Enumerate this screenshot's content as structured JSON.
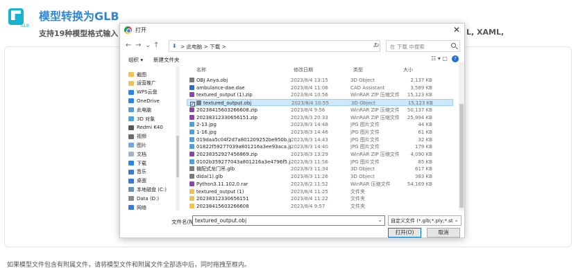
{
  "page": {
    "title": "模型转换为GLB",
    "subtitle": "支持19种模型格式输入：",
    "subtitle_tail": "L, XAML,",
    "logo_tag": "GLB",
    "footnote": "如果模型文件包含有附属文件，请将模型文件和附属文件全部选中后，同时拖拽至框内。"
  },
  "dialog": {
    "title": "打开",
    "close_glyph": "✕",
    "nav": {
      "back": "←",
      "forward": "→",
      "up_recent": "⌄",
      "up": "↑",
      "path": "> 此电脑 > 下载 >",
      "refresh": "↻",
      "search_placeholder": "在 下载 中搜索"
    },
    "toolbar": {
      "organize": "组织 ▾",
      "new_folder": "新建文件夹",
      "view_glyphs": "☷ ▾  ▢"
    },
    "sidebar": [
      {
        "label": "截图",
        "color": "#f2c14e"
      },
      {
        "label": "运营推广",
        "color": "#f2c14e"
      },
      {
        "label": "WPS云盘",
        "color": "#2a86e0"
      },
      {
        "label": "OneDrive",
        "color": "#2a86e0"
      },
      {
        "label": "此电脑",
        "color": "#5b9bd5"
      },
      {
        "label": "3D 对象",
        "color": "#4aa3df"
      },
      {
        "label": "Redmi K40",
        "color": "#555555"
      },
      {
        "label": "视频",
        "color": "#6b6b6b"
      },
      {
        "label": "图片",
        "color": "#6fa8dc"
      },
      {
        "label": "文档",
        "color": "#9fb5c9"
      },
      {
        "label": "下载",
        "color": "#2a86e0"
      },
      {
        "label": "音乐",
        "color": "#3c78d8"
      },
      {
        "label": "桌面",
        "color": "#3c78d8"
      },
      {
        "label": "本地磁盘 (C:)",
        "color": "#6b8fb5"
      },
      {
        "label": "Data (D:)",
        "color": "#8a8a8a"
      },
      {
        "label": "网络",
        "color": "#3c78d8"
      }
    ],
    "columns": {
      "name": "名称",
      "date": "修改日期",
      "type": "类型",
      "size": "大小"
    },
    "files": [
      {
        "name": "OBJ Anya.obj",
        "date": "2023/8/4 13:15",
        "type": "3D Object",
        "size": "2,137 KB",
        "icon": "#7a7a7a"
      },
      {
        "name": "ambulance-dae.dae",
        "date": "2023/8/4 11:06",
        "type": "CAD Assistant",
        "size": "3,589 KB",
        "icon": "#1f6fd1"
      },
      {
        "name": "textured_output (1).zip",
        "date": "2023/8/4 10:56",
        "type": "WinRAR ZIP 压缩文件",
        "size": "15,123 KB",
        "icon": "#8e44ad"
      },
      {
        "name": "textured_output.obj",
        "date": "2023/8/4 10:55",
        "type": "3D Object",
        "size": "15,123 KB",
        "icon": "#7a7a7a",
        "selected": true
      },
      {
        "name": "20238415603266608.zip",
        "date": "2023/8/4 9:56",
        "type": "WinRAR ZIP 压缩文件",
        "size": "50,137 KB",
        "icon": "#8e44ad"
      },
      {
        "name": "20238312330656151.zip",
        "date": "2023/8/3 20:33",
        "type": "WinRAR ZIP 压缩文件",
        "size": "25,994 KB",
        "icon": "#8e44ad"
      },
      {
        "name": "2-13.jpg",
        "date": "2023/8/3 14:48",
        "type": "JPG 图片文件",
        "size": "44 KB",
        "icon": "#4aa3df"
      },
      {
        "name": "1-16.jpg",
        "date": "2023/8/3 14:46",
        "type": "JPG 图片文件",
        "size": "61 KB",
        "icon": "#4aa3df"
      },
      {
        "name": "019daa5c04f2d7a801209252be950b.jpg...",
        "date": "2023/8/3 14:43",
        "type": "JPG 图片文件",
        "size": "32 KB",
        "icon": "#4aa3df"
      },
      {
        "name": "01822f59277039a801216a3ee93aca.jpg",
        "date": "2023/8/3 14:40",
        "type": "JPG 图片文件",
        "size": "179 KB",
        "icon": "#4aa3df"
      },
      {
        "name": "20238352927456869.zip",
        "date": "2023/8/3 13:29",
        "type": "WinRAR ZIP 压缩文件",
        "size": "4,090 KB",
        "icon": "#8e44ad"
      },
      {
        "name": "0102b359277043a801216a3e4796f5.jpg",
        "date": "2023/8/3 11:56",
        "type": "JPG 图片文件",
        "size": "85 KB",
        "icon": "#4aa3df"
      },
      {
        "name": "機配式龙门吊.glb",
        "date": "2023/8/3 11:34",
        "type": "3D Object",
        "size": "617 KB",
        "icon": "#7a7a7a"
      },
      {
        "name": "dida(1).glb",
        "date": "2023/8/3 11:26",
        "type": "3D Object",
        "size": "383 KB",
        "icon": "#7a7a7a"
      },
      {
        "name": "Python3.11.102.0.rar",
        "date": "2023/8/2 11:52",
        "type": "WinRAR 压缩文件",
        "size": "54,169 KB",
        "icon": "#8e44ad"
      },
      {
        "name": "textured_output (1)",
        "date": "2023/8/4 11:25",
        "type": "文件夹",
        "size": "",
        "icon": "#f2c14e"
      },
      {
        "name": "20238312330656151",
        "date": "2023/8/4 11:22",
        "type": "文件夹",
        "size": "",
        "icon": "#f2c14e"
      },
      {
        "name": "20238415603266608",
        "date": "2023/8/4 9:57",
        "type": "文件夹",
        "size": "",
        "icon": "#f2c14e"
      }
    ],
    "filename_label": "文件名(N):",
    "filename_value": "textured_output.obj",
    "filter": "自定义文件 (*.glb;*.ply;*.stl;*.c",
    "open_button": "打开(O)",
    "cancel_button": "取消"
  },
  "colors": {
    "accent": "#2f88d6",
    "logo": "#17b3d0",
    "selection": "#cce8ff"
  }
}
